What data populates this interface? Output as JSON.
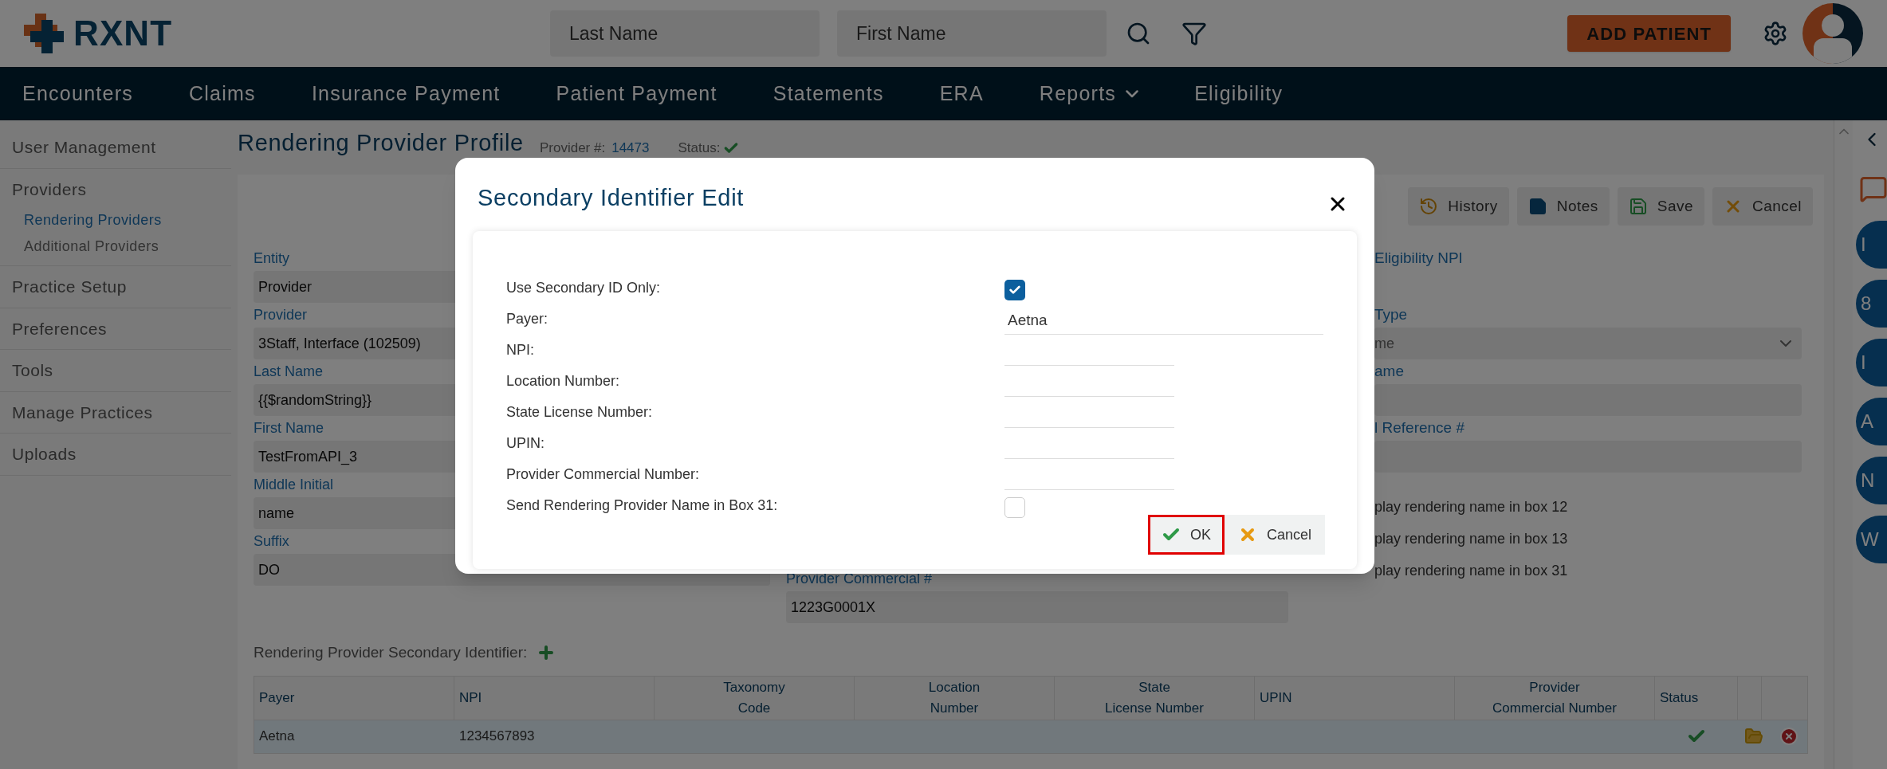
{
  "header": {
    "logo_text": "RXNT",
    "search_fields": [
      {
        "placeholder": "Last Name"
      },
      {
        "placeholder": "First Name"
      }
    ],
    "add_patient": "ADD PATIENT"
  },
  "nav": [
    {
      "label": "Encounters",
      "has_menu": false
    },
    {
      "label": "Claims",
      "has_menu": false
    },
    {
      "label": "Insurance Payment",
      "has_menu": false
    },
    {
      "label": "Patient Payment",
      "has_menu": false
    },
    {
      "label": "Statements",
      "has_menu": false
    },
    {
      "label": "ERA",
      "has_menu": false
    },
    {
      "label": "Reports",
      "has_menu": true
    },
    {
      "label": "Eligibility",
      "has_menu": false
    }
  ],
  "sidebar": {
    "items": [
      {
        "label": "User Management"
      },
      {
        "label": "Providers",
        "children": [
          {
            "label": "Rendering Providers",
            "selected": true
          },
          {
            "label": "Additional Providers",
            "selected": false
          }
        ]
      },
      {
        "label": "Practice Setup"
      },
      {
        "label": "Preferences"
      },
      {
        "label": "Tools"
      },
      {
        "label": "Manage Practices"
      },
      {
        "label": "Uploads"
      }
    ]
  },
  "page": {
    "title": "Rendering Provider Profile",
    "provider_label": "Provider #:",
    "provider_number": "14473",
    "status_label": "Status:",
    "status_ok": true
  },
  "toolbar": [
    {
      "kind": "history",
      "label": "History"
    },
    {
      "kind": "notes",
      "label": "Notes"
    },
    {
      "kind": "save",
      "label": "Save"
    },
    {
      "kind": "cancel",
      "label": "Cancel"
    }
  ],
  "left_fields": [
    {
      "label": "Entity",
      "value": "Provider"
    },
    {
      "label": "Provider",
      "value": "3Staff, Interface  (102509)"
    },
    {
      "label": "Last Name",
      "value": "{{$randomString}}"
    },
    {
      "label": "First Name",
      "value": "TestFromAPI_3"
    },
    {
      "label": "Middle Initial",
      "value": "name"
    },
    {
      "label": "Suffix",
      "value": "DO"
    }
  ],
  "middle_fields": [
    {
      "label": "Provider Commercial #",
      "value": "1223G0001X"
    }
  ],
  "right_fields": [
    {
      "kind": "label",
      "label": "Eligibility NPI"
    },
    {
      "kind": "select",
      "label": "Type",
      "value": "me"
    },
    {
      "kind": "text",
      "label": "ame"
    },
    {
      "kind": "text",
      "label": "l Reference #"
    }
  ],
  "right_checks": [
    "play rendering name in box 12",
    "play rendering name in box 13",
    "play rendering name in box 31"
  ],
  "table": {
    "title": "Rendering Provider Secondary Identifier:",
    "columns": [
      "Payer",
      "NPI",
      "Taxonomy\nCode",
      "Location\nNumber",
      "State\nLicense Number",
      "UPIN",
      "Provider\nCommercial Number",
      "Status"
    ],
    "rows": [
      {
        "payer": "Aetna",
        "npi": "1234567893",
        "status_ok": true,
        "selected": true
      }
    ]
  },
  "modal": {
    "title": "Secondary Identifier Edit",
    "rows": [
      {
        "kind": "checkbox",
        "label": "Use Secondary ID Only:",
        "checked": true
      },
      {
        "kind": "wide",
        "label": "Payer:",
        "value": "Aetna"
      },
      {
        "kind": "text",
        "label": "NPI:"
      },
      {
        "kind": "text",
        "label": "Location Number:"
      },
      {
        "kind": "text",
        "label": "State License Number:"
      },
      {
        "kind": "text",
        "label": "UPIN:"
      },
      {
        "kind": "text",
        "label": "Provider Commercial Number:"
      },
      {
        "kind": "checkbox",
        "label": "Send Rendering Provider Name in Box 31:",
        "checked": false
      }
    ],
    "buttons": [
      {
        "kind": "ok",
        "label": "OK",
        "outlined": true
      },
      {
        "kind": "cancel",
        "label": "Cancel",
        "outlined": false
      }
    ]
  },
  "rail": {
    "avatars": [
      "I",
      "8",
      "I",
      "A",
      "N",
      "W"
    ]
  }
}
